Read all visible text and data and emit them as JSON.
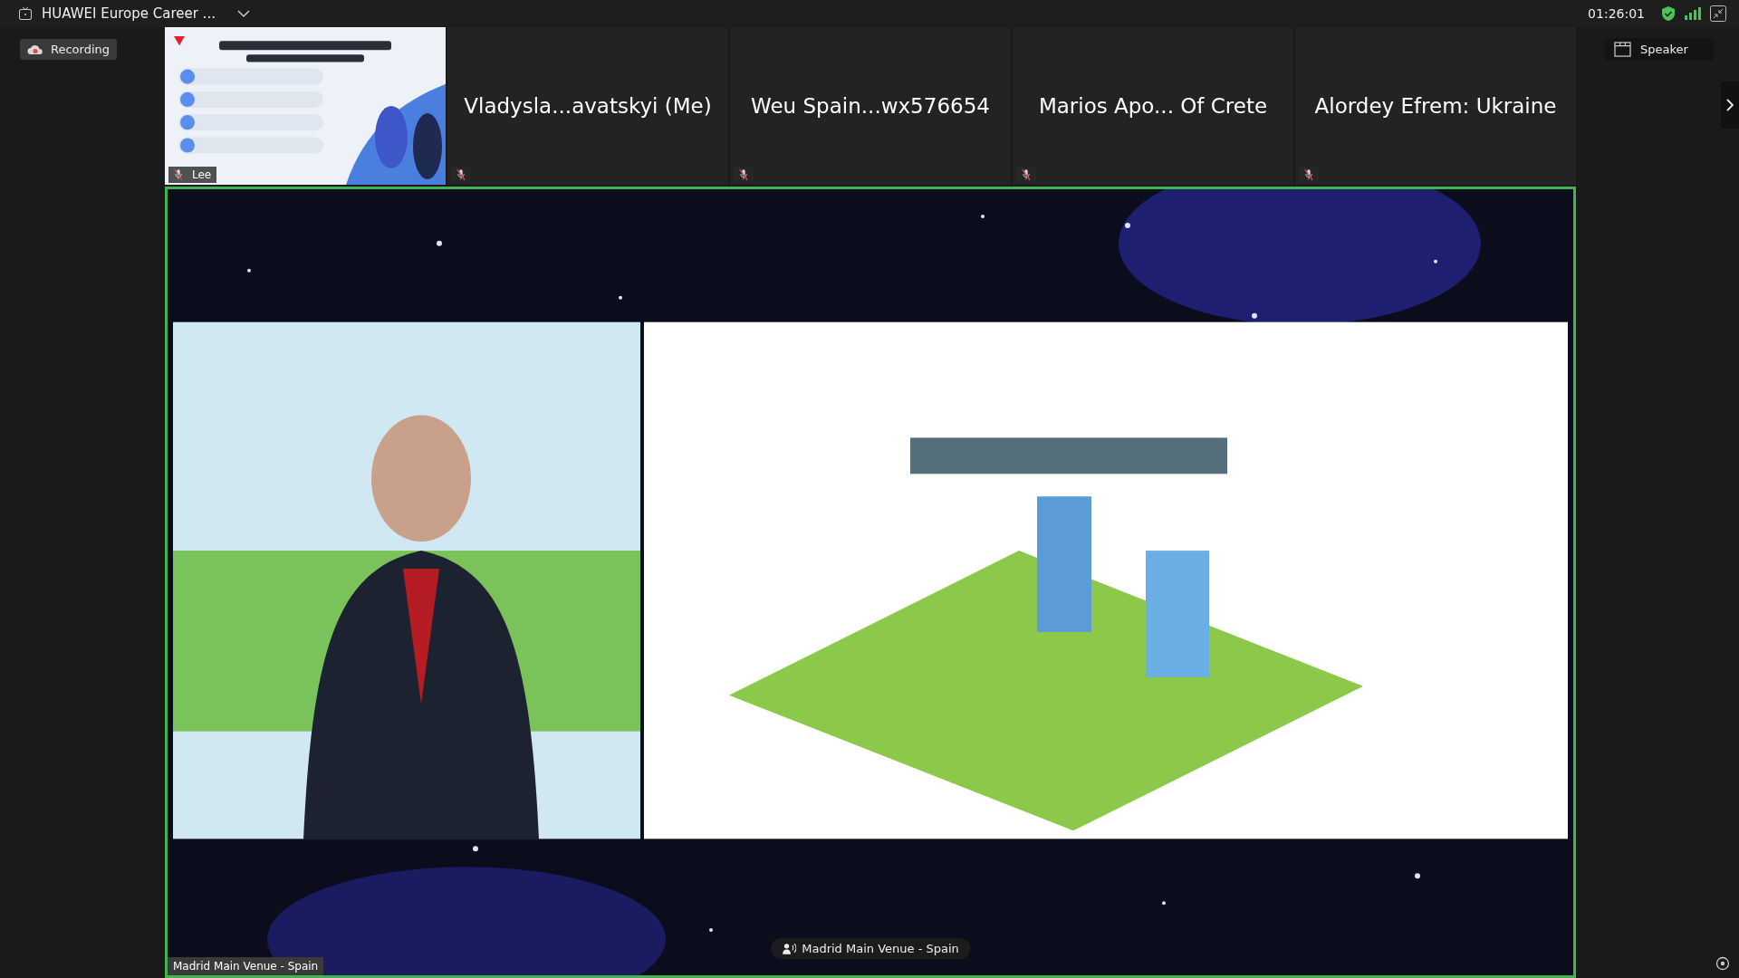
{
  "window": {
    "title": "HUAWEI Europe Career ...",
    "time": "01:26:01"
  },
  "recording": {
    "label": "Recording"
  },
  "view_button": {
    "label": "Speaker"
  },
  "participants": [
    {
      "kind": "video",
      "name": "Lee",
      "muted": true
    },
    {
      "kind": "name",
      "name": "Vladysla...avatskyi (Me)",
      "muted": true
    },
    {
      "kind": "name",
      "name": "Weu Spain...wx576654",
      "muted": true
    },
    {
      "kind": "name",
      "name": "Marios Apo... Of Crete",
      "muted": true
    },
    {
      "kind": "name",
      "name": "Alordey Efrem: Ukraine",
      "muted": true
    }
  ],
  "main_video": {
    "kind": "picture",
    "name_label": "Madrid Main Venue - Spain",
    "speaker_label": "Madrid Main Venue - Spain"
  }
}
